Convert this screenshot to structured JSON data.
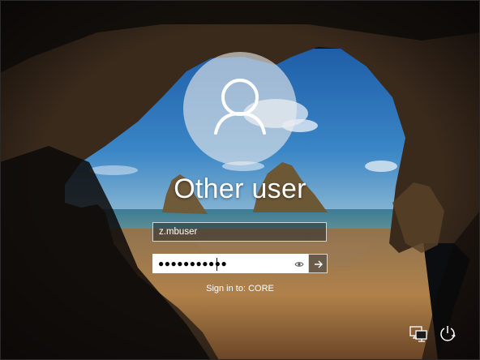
{
  "login": {
    "user_title": "Other user",
    "username_value": "z.mbuser",
    "password_masked": "●●●●●●●●●●●",
    "sign_in_to": "Sign in to: CORE"
  },
  "icons": {
    "avatar": "user-silhouette-icon",
    "reveal": "eye-icon",
    "submit": "arrow-right-icon",
    "network": "network-icon",
    "power": "power-icon"
  },
  "colors": {
    "sky": "#2a6fb5",
    "sea": "#3c7c95",
    "sand": "#b8864e",
    "cave": "#15100c"
  }
}
